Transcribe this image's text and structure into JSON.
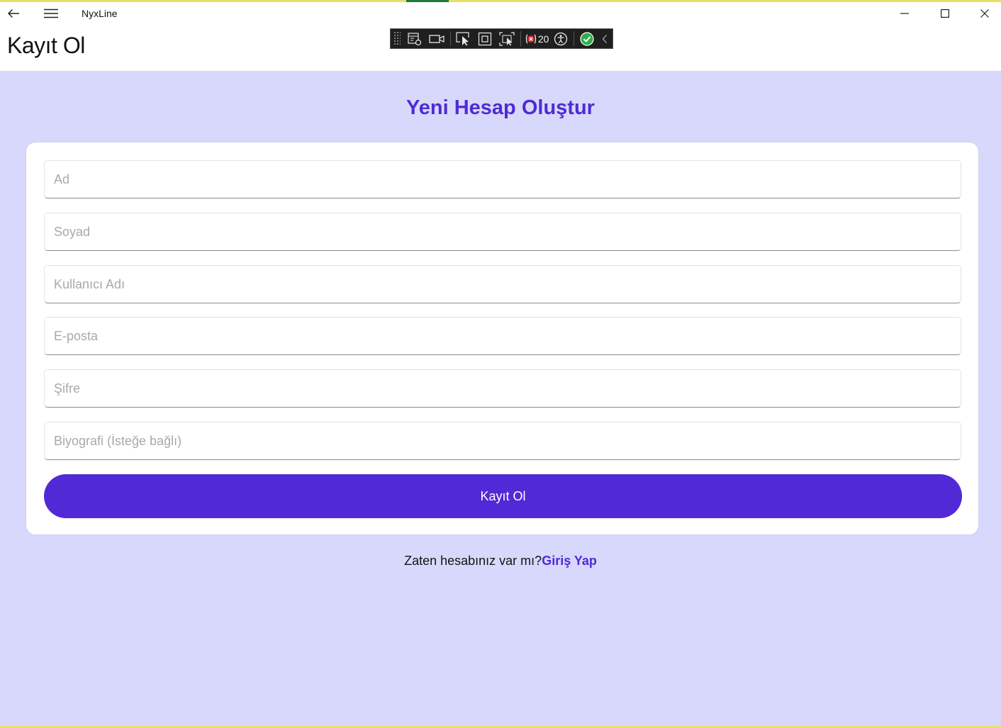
{
  "window": {
    "title": "NyxLine",
    "controls": {
      "minimize_icon": "minimize-icon",
      "maximize_icon": "maximize-icon",
      "close_icon": "close-icon"
    }
  },
  "header": {
    "title": "Kayıt Ol"
  },
  "debug_toolbar": {
    "items": [
      "live-visual-tree-icon",
      "record-icon",
      "select-element-icon",
      "display-layout-adorners-icon",
      "track-focused-element-icon",
      "binding-failures-icon",
      "accessibility-icon",
      "check-icon",
      "collapse-icon"
    ],
    "binding_failures_count": "20"
  },
  "form": {
    "heading": "Yeni Hesap Oluştur",
    "fields": {
      "first_name": {
        "placeholder": "Ad",
        "value": ""
      },
      "last_name": {
        "placeholder": "Soyad",
        "value": ""
      },
      "username": {
        "placeholder": "Kullanıcı Adı",
        "value": ""
      },
      "email": {
        "placeholder": "E-posta",
        "value": ""
      },
      "password": {
        "placeholder": "Şifre",
        "value": ""
      },
      "bio": {
        "placeholder": "Biyografi (İsteğe bağlı)",
        "value": ""
      }
    },
    "submit_label": "Kayıt Ol"
  },
  "footer": {
    "prompt": "Zaten hesabınız var mı?",
    "login_link": "Giriş Yap"
  },
  "colors": {
    "accent": "#5229d6",
    "heading": "#4f2bd4",
    "background": "#d8d8fc",
    "card": "#ffffff"
  }
}
